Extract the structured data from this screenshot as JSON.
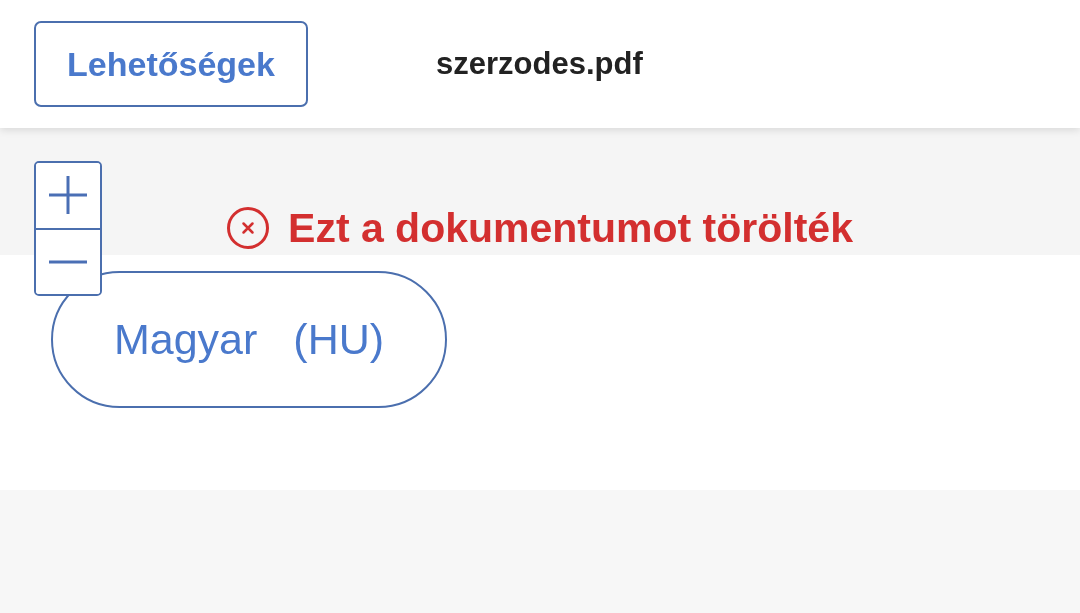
{
  "header": {
    "options_button": "Lehetőségek",
    "file_name": "szerzodes.pdf"
  },
  "error": {
    "message": "Ezt a dokumentumot törölték"
  },
  "language_button": {
    "name": "Magyar",
    "code": "(HU)"
  }
}
